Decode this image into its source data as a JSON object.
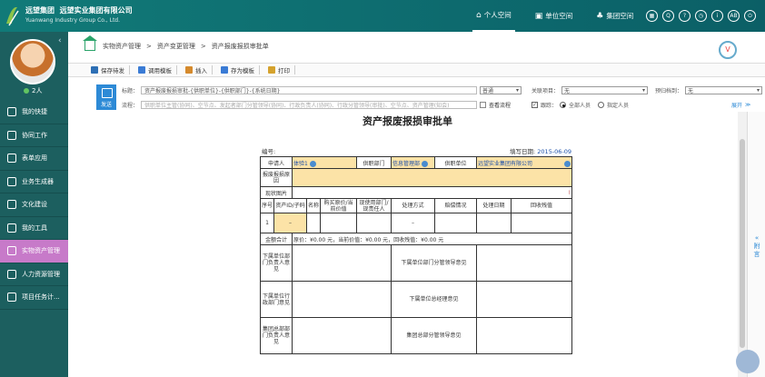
{
  "brand": {
    "name": "远望集团",
    "company": "远望实业集团有限公司",
    "english": "Yuanwang Industry Group Co., Ltd."
  },
  "topnav": [
    {
      "label": "个人空间",
      "icon": "home-icon",
      "active": true
    },
    {
      "label": "单位空间",
      "icon": "building-icon",
      "active": false
    },
    {
      "label": "集团空间",
      "icon": "group-icon",
      "active": false
    }
  ],
  "top_icons": [
    "grid-icon",
    "search-icon",
    "help-icon",
    "clock-icon",
    "info-icon",
    "ab-icon",
    "power-icon"
  ],
  "top_icon_glyphs": [
    "▦",
    "Q",
    "?",
    "◷",
    "i",
    "AB",
    "⏻"
  ],
  "user": {
    "count": "2人"
  },
  "menu": [
    {
      "label": "我的快捷",
      "active": false
    },
    {
      "label": "协同工作",
      "active": false
    },
    {
      "label": "表单应用",
      "active": false
    },
    {
      "label": "业务生成器",
      "active": false
    },
    {
      "label": "文化建设",
      "active": false
    },
    {
      "label": "我的工具",
      "active": false
    },
    {
      "label": "实物资产管理",
      "active": true
    },
    {
      "label": "人力资源管理",
      "active": false
    },
    {
      "label": "项目任务计...",
      "active": false
    }
  ],
  "breadcrumb": [
    "实物资产管理",
    "资产变更管理",
    "资产报废报损审批单"
  ],
  "toolbar": [
    {
      "label": "保存待发",
      "color": "#2d6fb5"
    },
    {
      "label": "调用模板",
      "color": "#3a7bd5"
    },
    {
      "label": "插入",
      "color": "#d58a2d"
    },
    {
      "label": "存为模板",
      "color": "#3a7bd5"
    },
    {
      "label": "打印",
      "color": "#d5a22d"
    }
  ],
  "send_label": "发送",
  "form_header": {
    "title_label": "标题：",
    "title_value": "资产报废报损审批-{供职单位}-{供职部门}-{系统日期}",
    "priority": "普通",
    "related_label": "关联项目：",
    "related_value": "无",
    "archive_label": "预归档到：",
    "archive_value": "无",
    "flow_label": "流程：",
    "flow_placeholder": "供职单位主管(协同)、空节点、发起者部门分管领导(协同)、行政负责人(协同)、行政分管领导(审批)、空节点、资产管理(知会)",
    "view_flow": "查看流程",
    "track_label": "跟踪：",
    "all_people": "全部人员",
    "specified_people": "指定人员",
    "expand": "展开"
  },
  "form": {
    "title": "资产报废报损审批单",
    "number_label": "编号:",
    "date_label": "填写日期:",
    "date_value": "2015-06-09",
    "applicant_label": "申请人",
    "applicant_value": "体验1",
    "dept_label": "供职部门",
    "dept_value": "信息管理部",
    "unit_label": "供职单位",
    "unit_value": "远望实业集团有限公司",
    "reason_label": "报废报损原因",
    "photo_label": "现状图片",
    "columns": [
      "序号",
      "资产ID/子码",
      "名称",
      "购买原价/当前价值",
      "现使用部门/现责任人",
      "处理方式",
      "赔偿情况",
      "处理日期",
      "回收残值"
    ],
    "row_no": "1",
    "total_label": "金额合计",
    "total_text": "原价：¥0.00 元，当前价值：¥0.00 元，回收残值：¥0.00 元",
    "opinions": [
      [
        "下属单位部门负责人意见",
        "下属单位部门分管领导意见"
      ],
      [
        "下属单位行政部门意见",
        "下属单位总经理意见"
      ],
      [
        "集团总部部门负责人意见",
        "集团总部分管领导意见"
      ]
    ]
  },
  "rightbar": "附言"
}
